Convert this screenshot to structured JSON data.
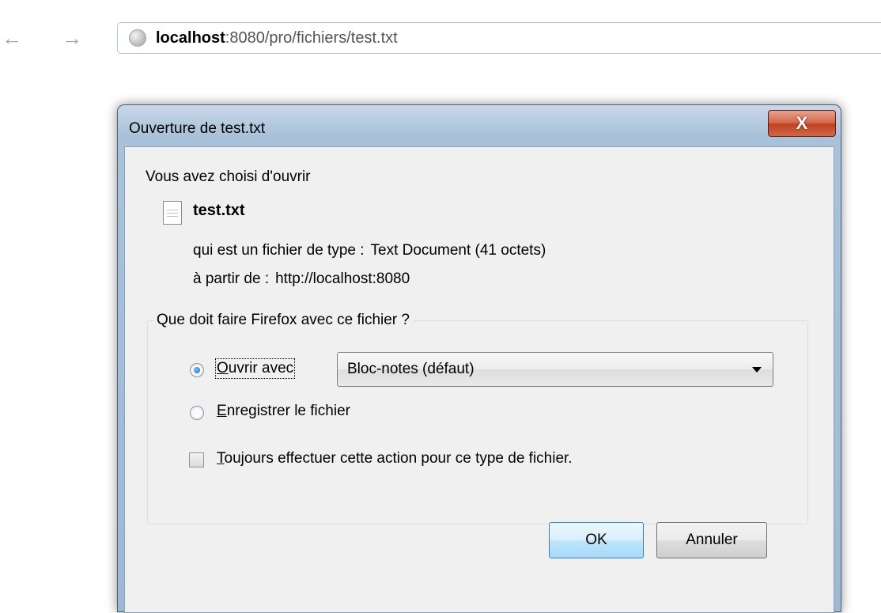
{
  "browser": {
    "url_host": "localhost",
    "url_rest": ":8080/pro/fichiers/test.txt",
    "back_icon": "arrow-left-icon",
    "forward_icon": "arrow-right-icon",
    "site_icon": "globe-icon"
  },
  "dialog": {
    "title": "Ouverture de test.txt",
    "close_label": "X",
    "intro": "Vous avez choisi d'ouvrir",
    "file_name": "test.txt",
    "type_label": "qui est un fichier de type :",
    "type_value": "Text Document (41 octets)",
    "from_label": "à partir de :",
    "from_value": "http://localhost:8080",
    "group_title": "Que doit faire Firefox avec ce fichier ?",
    "options": {
      "open_with": {
        "accel": "O",
        "rest": "uvrir avec",
        "selected": true
      },
      "save": {
        "accel": "E",
        "rest": "nregistrer le fichier",
        "selected": false
      },
      "always": {
        "accel": "T",
        "rest": "oujours effectuer cette action pour ce type de fichier.",
        "checked": false
      }
    },
    "application_select": {
      "value": "Bloc-notes (défaut)"
    },
    "buttons": {
      "ok": "OK",
      "cancel": "Annuler"
    }
  }
}
